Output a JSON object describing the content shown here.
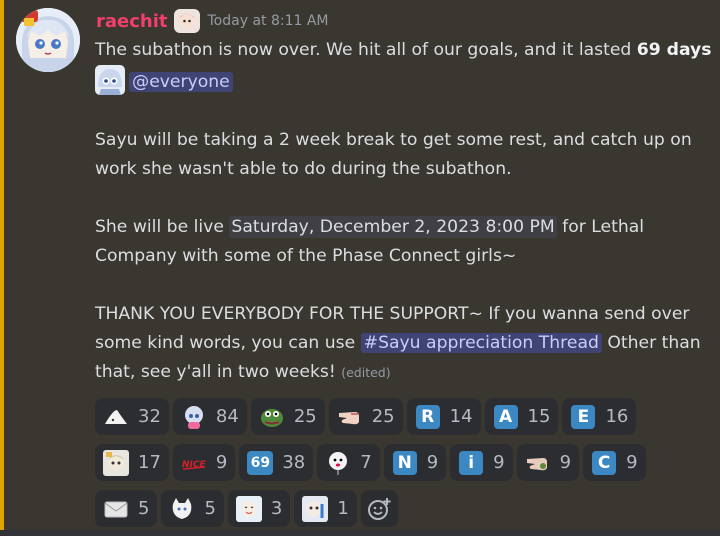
{
  "message": {
    "username": "raechit",
    "timestamp": "Today at 8:11 AM",
    "line1_prefix": "The subathon is now over. We hit all of our goals, and it lasted ",
    "line1_bold": "69 days",
    "mention": "@everyone",
    "para2": "Sayu will be taking a 2 week break to get some rest, and catch up on work she wasn't able to do during the subathon.",
    "para3_prefix": "She will be live ",
    "para3_time": "Saturday, December 2, 2023 8:00 PM",
    "para3_suffix": " for Lethal Company with some of the Phase Connect girls~",
    "para4_prefix": "THANK YOU EVERYBODY FOR THE SUPPORT~ If you wanna send over some kind words, you can use ",
    "channel": "Sayu appreciation Thread",
    "para4_suffix": " Other than that, see y'all in two weeks!",
    "edited": "(edited)"
  },
  "reactions": [
    {
      "emoji": "shark-icon",
      "count": "32"
    },
    {
      "emoji": "sayu-pink-icon",
      "count": "84"
    },
    {
      "emoji": "pepe-icon",
      "count": "25"
    },
    {
      "emoji": "pointing-hand-icon",
      "count": "25"
    },
    {
      "emoji": "letter-r-icon",
      "count": "14"
    },
    {
      "emoji": "letter-a-icon",
      "count": "15"
    },
    {
      "emoji": "letter-e-icon",
      "count": "16"
    },
    {
      "emoji": "sayu-chibi-icon",
      "count": "17"
    },
    {
      "emoji": "nice-text-icon",
      "count": "9"
    },
    {
      "emoji": "number-69-icon",
      "count": "38"
    },
    {
      "emoji": "balloon-face-icon",
      "count": "7"
    },
    {
      "emoji": "letter-n-icon",
      "count": "9"
    },
    {
      "emoji": "letter-i-icon",
      "count": "9"
    },
    {
      "emoji": "pointing-hand-2-icon",
      "count": "9"
    },
    {
      "emoji": "letter-c-icon",
      "count": "9"
    },
    {
      "emoji": "envelope-icon",
      "count": "5"
    },
    {
      "emoji": "cat-sticker-icon",
      "count": "5"
    },
    {
      "emoji": "sayu-happy-icon",
      "count": "3"
    },
    {
      "emoji": "sayu-cry-icon",
      "count": "1"
    }
  ],
  "colors": {
    "username": "#f23f6d",
    "mention_bg": "#3f4475",
    "letter_emoji_bg": "#3b88c3",
    "accent_bar": "#e0a400"
  },
  "add_reaction_icon": "add-reaction-icon"
}
